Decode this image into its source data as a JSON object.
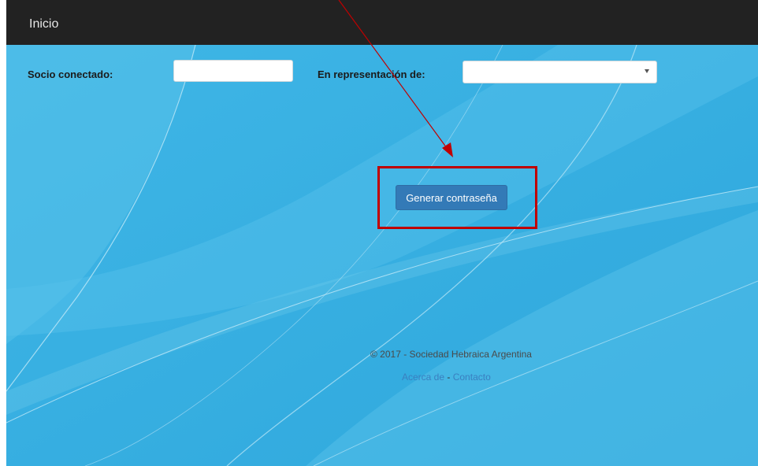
{
  "navbar": {
    "brand": "Inicio"
  },
  "form": {
    "socio_label": "Socio conectado:",
    "socio_value": "",
    "representacion_label": "En representación de:",
    "representacion_value": ""
  },
  "actions": {
    "generate_label": "Generar contraseña"
  },
  "footer": {
    "copyright": "© 2017 - Sociedad Hebraica Argentina",
    "about_link": "Acerca de",
    "separator": "-",
    "contact_link": "Contacto"
  },
  "colors": {
    "navbar": "#222222",
    "background": "#35aee2",
    "button": "#337ab7",
    "annotation": "#c00000"
  }
}
